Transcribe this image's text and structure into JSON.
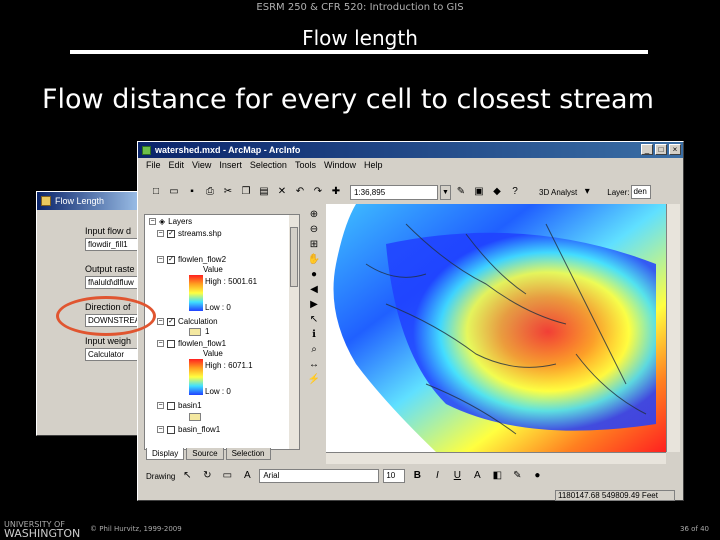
{
  "slide": {
    "course": "ESRM 250 & CFR 520: Introduction to GIS",
    "title": "Flow length",
    "heading": "Flow distance for every cell to closest stream",
    "logo_line1": "UNIVERSITY OF",
    "logo_line2": "WASHINGTON",
    "copyright": "© Phil Hurvitz, 1999-2009",
    "page": "36 of 40"
  },
  "dialog": {
    "title": "Flow Length",
    "labels": [
      "Input flow d",
      "Output raste",
      "Direction of",
      "Input weigh"
    ],
    "fields": [
      "flowdir_fill1",
      "fl\\aluld\\dlfluw",
      "DOWNSTREAM",
      "Calculator"
    ]
  },
  "arcmap": {
    "title": "watershed.mxd - ArcMap - ArcInfo",
    "menu": [
      "File",
      "Edit",
      "View",
      "Insert",
      "Selection",
      "Tools",
      "Window",
      "Help"
    ],
    "scale": "1:36,895",
    "analyst_label": "3D Analyst",
    "layer_label": "Layer:",
    "layer_value": "den",
    "toc": {
      "root": "Layers",
      "layers": [
        {
          "name": "streams.shp"
        },
        {
          "name": "flowlen_flow2",
          "value_label": "Value",
          "high": "High : 5001.61",
          "low": "Low : 0"
        },
        {
          "name": "flowlen_flow1",
          "value_label": "Value",
          "high": "High : 6071.1",
          "low": "Low : 0"
        },
        {
          "name": "Calculation",
          "class_value": "1"
        },
        {
          "name": "basin1"
        },
        {
          "name": "basin_flow1"
        }
      ]
    },
    "tabs": [
      "Display",
      "Source",
      "Selection"
    ],
    "drawing_label": "Drawing",
    "font": "Arial",
    "font_size": "10",
    "status": "1180147.68  549809.49 Feet"
  }
}
